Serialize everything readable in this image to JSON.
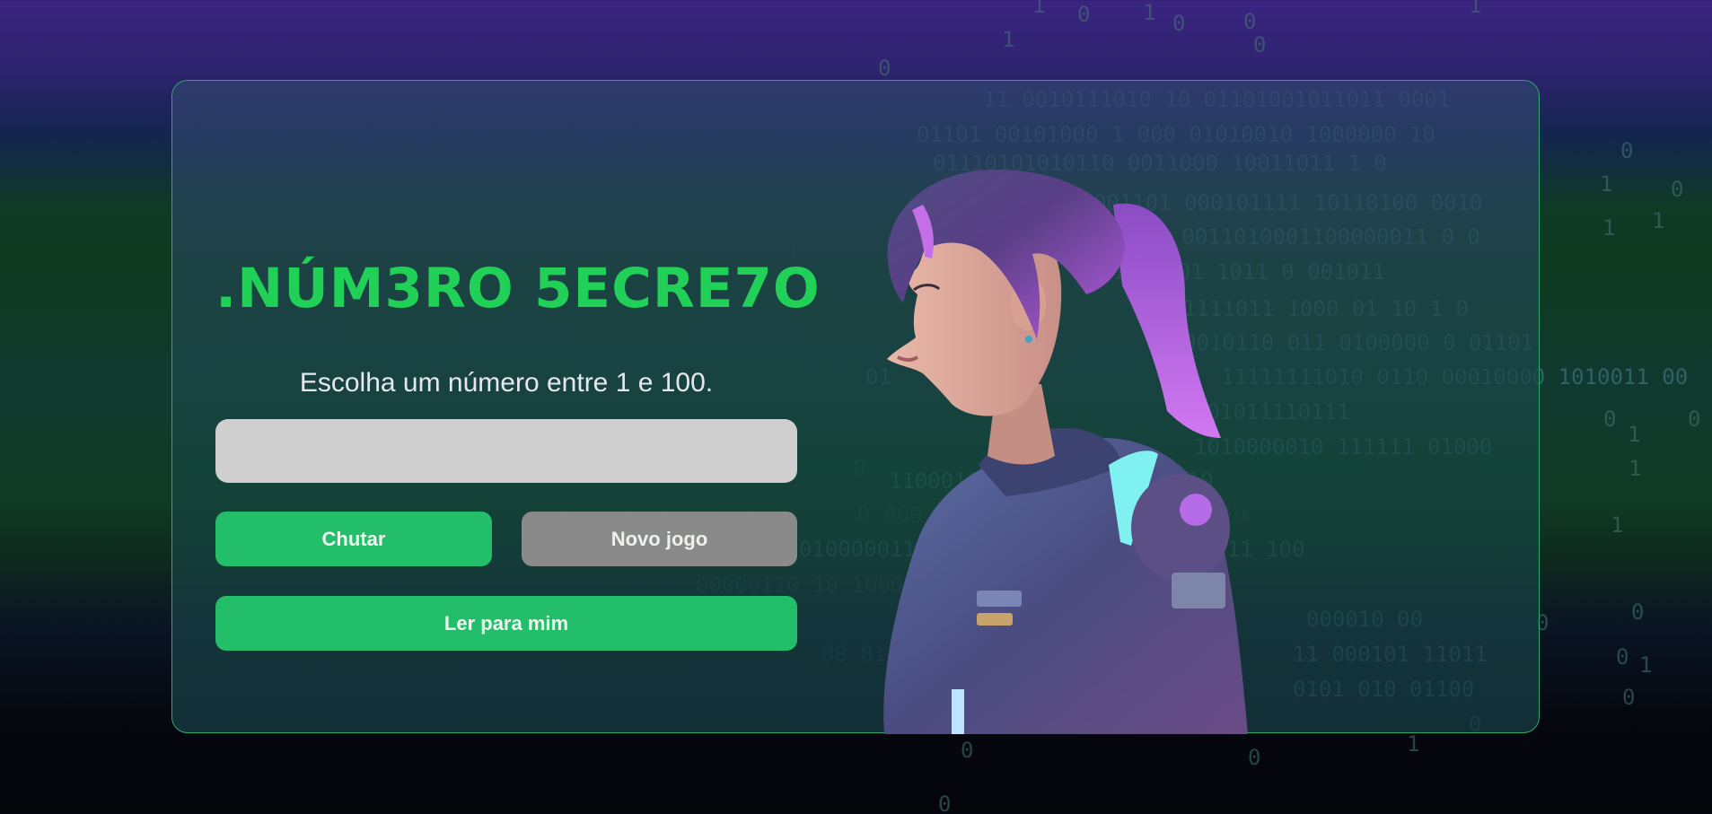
{
  "game": {
    "title": ".NÚM3RO 5ECRE7O",
    "instructions": "Escolha um número entre 1 e 100.",
    "input_value": "",
    "input_placeholder": ""
  },
  "buttons": {
    "guess_label": "Chutar",
    "new_game_label": "Novo jogo",
    "read_aloud_label": "Ler para mim"
  },
  "illustration": {
    "icon": "character-illustration"
  },
  "background": {
    "rain_rows": [
      "1 0 1 0 0",
      "1 0",
      "11 0010111010 10 01101001011011 0001",
      "01101 00101000 1 000 01010010 1000000 10",
      "01110101010110 0011000 10011011 1 0",
      "00001101 000101111 10110100 0010",
      "011 00110100011000000 1 0 0",
      "0 01 0 1 0 1 1 1 0 1 0011",
      "1111011 1000 01 10 1 0",
      "0010110 011 01 0 0 01101",
      "11111111010 0110 00010000 1010011 00",
      "001011110111",
      "1010000010 111111 01000",
      "11000110 0011010001101110",
      "0 000 0 0 1010 0001 11000 1010",
      "0100000110001 1011 10 000011 1 0 11 100",
      "00000110 10 1000000111110000 11 0",
      "000010 00",
      "00 01 11 000101 11011",
      "0101 010 01100"
    ],
    "colors": {
      "accent_green": "#21d157",
      "button_green": "#22be6a",
      "button_gray": "#8a8a8a",
      "input_bg": "#cfcfcf",
      "card_border": "#2ea96a"
    }
  }
}
